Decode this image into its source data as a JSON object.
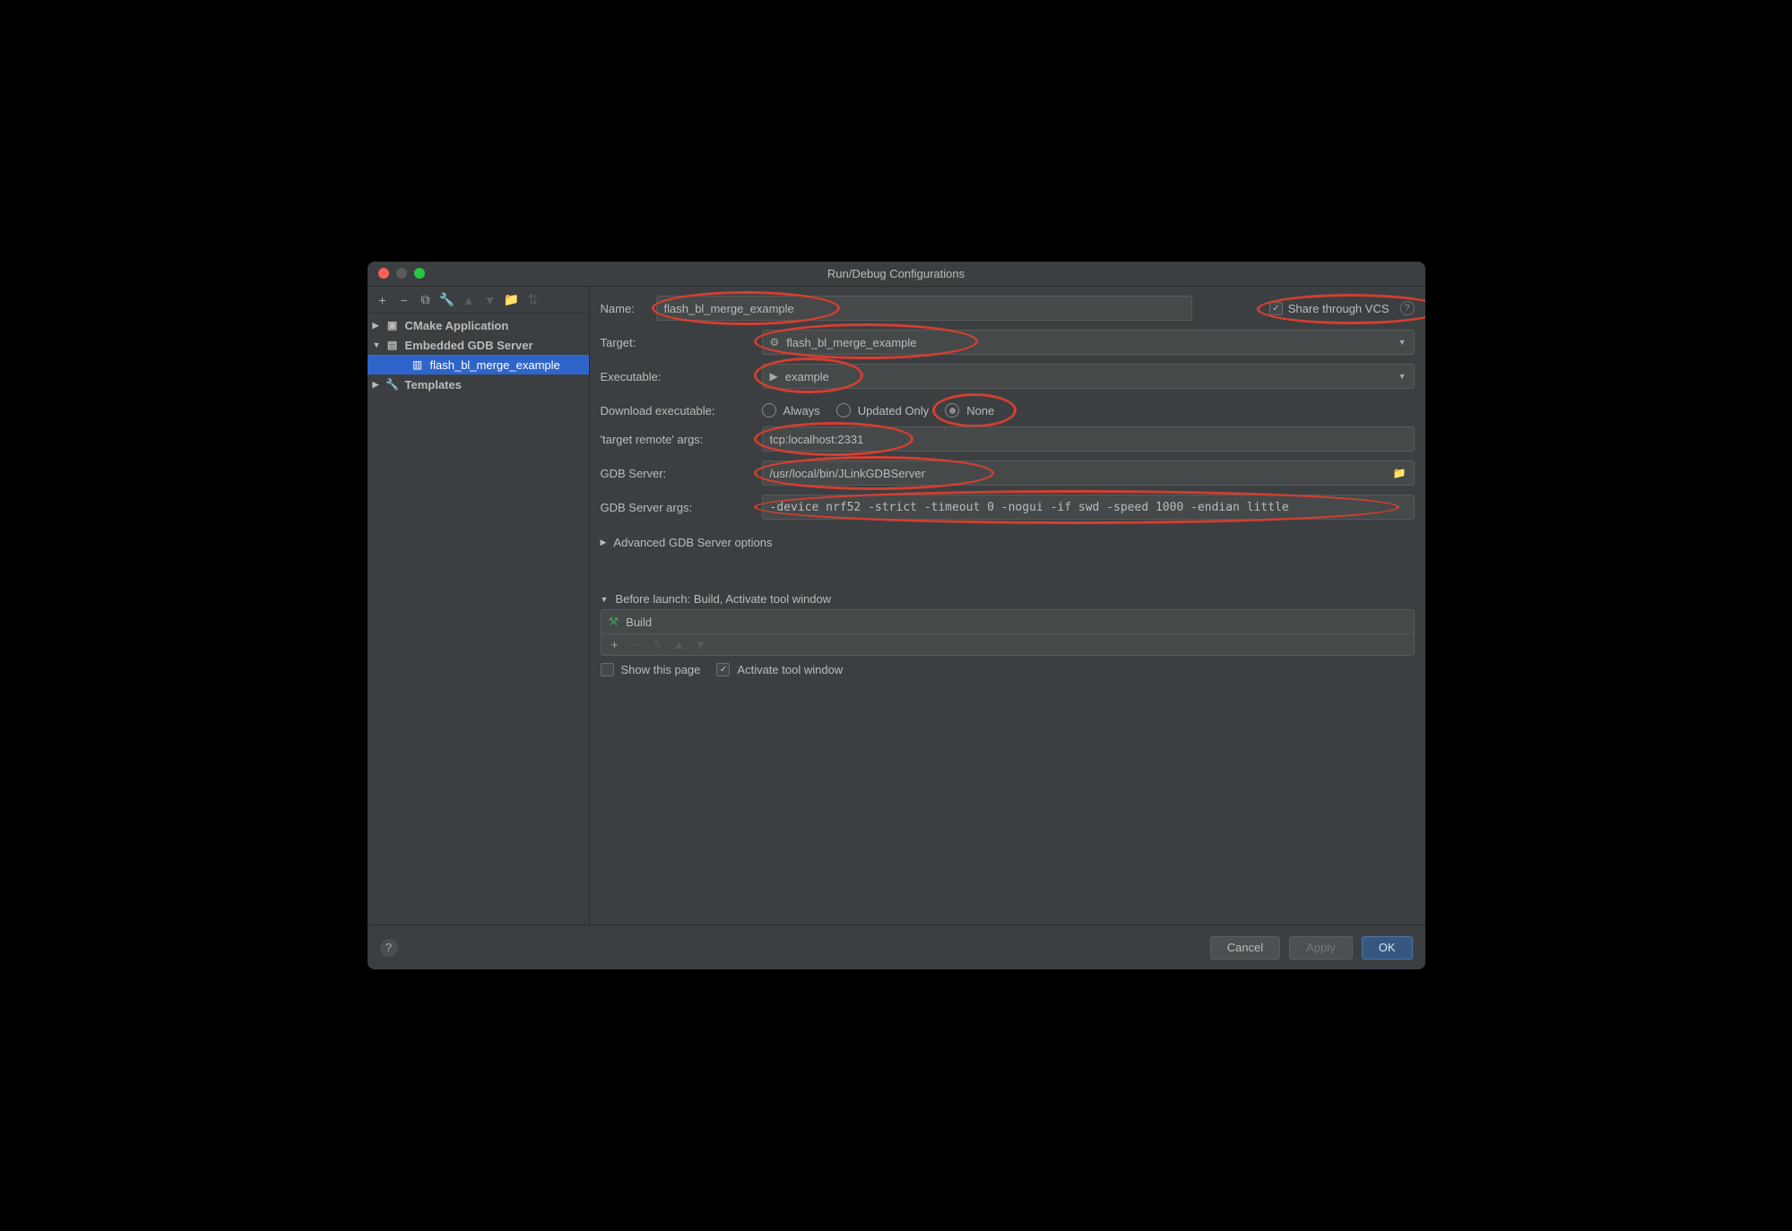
{
  "title": "Run/Debug Configurations",
  "toolbar": {
    "add_icon": "+",
    "remove_icon": "−",
    "copy_icon": "⧉",
    "wrench_icon": "🔧",
    "up_icon": "▲",
    "down_icon": "▼",
    "folder_icon": "📁",
    "sort_icon": "⇅"
  },
  "tree": {
    "cmake_app": "CMake Application",
    "gdb_server": "Embedded GDB Server",
    "config_name": "flash_bl_merge_example",
    "templates": "Templates"
  },
  "form": {
    "name_label": "Name:",
    "name_value": "flash_bl_merge_example",
    "share_label": "Share through VCS",
    "target_label": "Target:",
    "target_value": "flash_bl_merge_example",
    "executable_label": "Executable:",
    "executable_value": "example",
    "download_label": "Download executable:",
    "always": "Always",
    "updated": "Updated Only",
    "none": "None",
    "remote_label": "'target remote' args:",
    "remote_value": "tcp:localhost:2331",
    "gdb_server_label": "GDB Server:",
    "gdb_server_value": "/usr/local/bin/JLinkGDBServer",
    "gdb_args_label": "GDB Server args:",
    "gdb_args_value": "-device nrf52 -strict -timeout 0 -nogui -if swd -speed 1000 -endian little",
    "advanced": "Advanced GDB Server options",
    "before_label": "Before launch: Build, Activate tool window",
    "build_item": "Build",
    "show_page": "Show this page",
    "activate_window": "Activate tool window"
  },
  "footer": {
    "cancel": "Cancel",
    "apply": "Apply",
    "ok": "OK"
  }
}
